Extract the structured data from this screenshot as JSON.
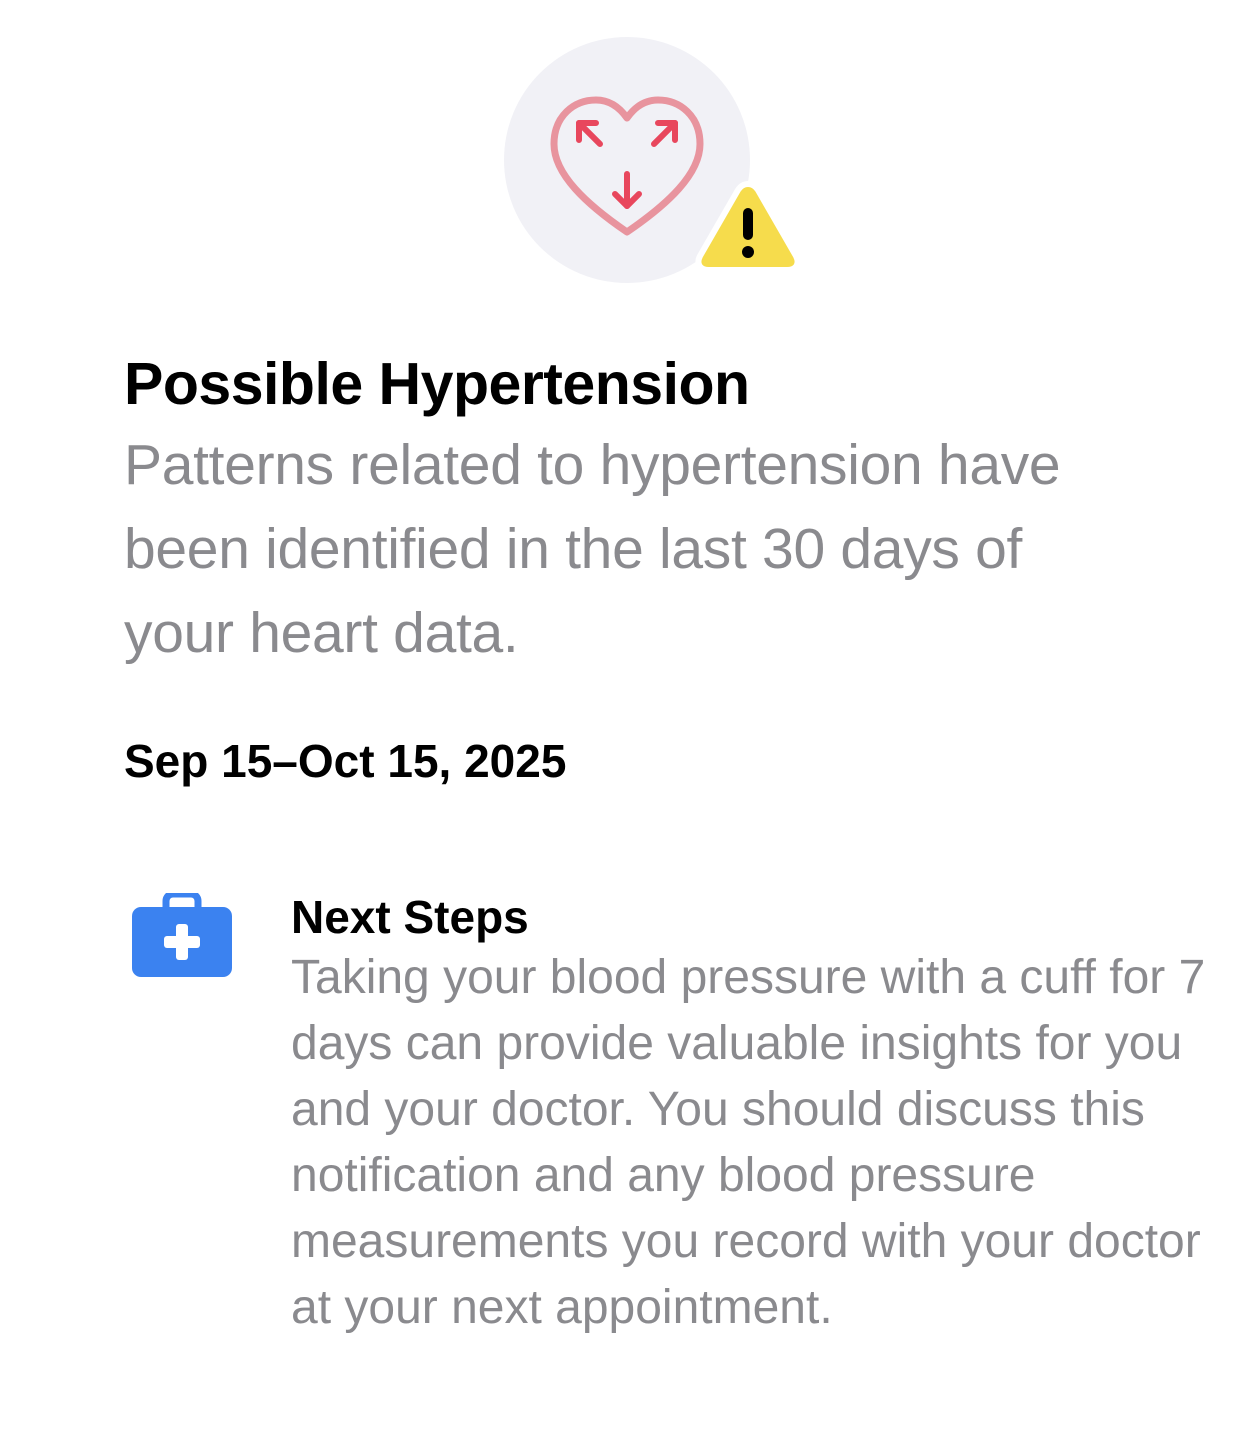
{
  "alert": {
    "title": "Possible Hypertension",
    "description": "Patterns related to hypertension have been identified in the last 30 days of your heart data.",
    "date_range": "Sep 15–Oct 15, 2025",
    "hero_icon": "heart-arrows-icon",
    "badge_icon": "warning-icon"
  },
  "next_steps": {
    "icon": "medical-kit-icon",
    "title": "Next Steps",
    "body": "Taking your blood pressure with a cuff for 7 days can provide valuable insights for you and your doctor. You should discuss this notification and any blood pressure measurements you record with your doctor at your next appointment."
  },
  "colors": {
    "heart_outline": "#e8949e",
    "heart_arrows": "#e8475d",
    "warning_fill": "#f6dc4c",
    "kit_blue": "#3b82f0",
    "secondary_text": "#8a8a8e",
    "hero_background": "#f1f1f6"
  }
}
